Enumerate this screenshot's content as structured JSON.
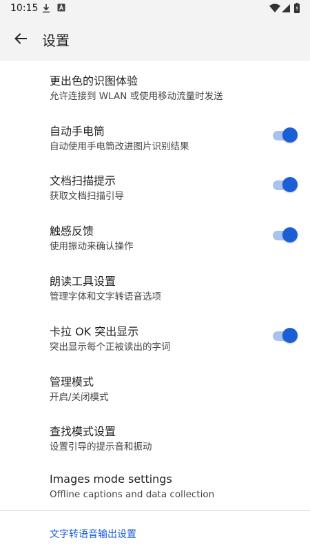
{
  "status_bar": {
    "time": "10:15",
    "icons": [
      "download-icon",
      "font-app-icon",
      "wifi-icon",
      "signal-icon",
      "battery-icon"
    ]
  },
  "app_bar": {
    "title": "设置",
    "back_icon": "arrow-back-icon"
  },
  "settings": [
    {
      "title": "更出色的识图体验",
      "subtitle": "允许连接到 WLAN 或使用移动流量时发送",
      "has_toggle": false
    },
    {
      "title": "自动手电筒",
      "subtitle": "自动使用手电筒改进图片识别结果",
      "has_toggle": true,
      "on": true
    },
    {
      "title": "文档扫描提示",
      "subtitle": "获取文档扫描引导",
      "has_toggle": true,
      "on": true
    },
    {
      "title": "触感反馈",
      "subtitle": "使用振动来确认操作",
      "has_toggle": true,
      "on": true
    },
    {
      "title": "朗读工具设置",
      "subtitle": "管理字体和文字转语音选项",
      "has_toggle": false
    },
    {
      "title": "卡拉 OK 突出显示",
      "subtitle": "突出显示每个正被读出的字词",
      "has_toggle": true,
      "on": true
    },
    {
      "title": "管理模式",
      "subtitle": "开启/关闭模式",
      "has_toggle": false
    },
    {
      "title": "查找模式设置",
      "subtitle": "设置引导的提示音和振动",
      "has_toggle": false
    },
    {
      "title": "Images mode settings",
      "subtitle": "Offline captions and data collection",
      "has_toggle": false
    }
  ],
  "footer_link": "文字转语音输出设置",
  "colors": {
    "accent": "#1a5fd6",
    "track": "#a9c3f0",
    "header_bg": "#f3f3f3"
  }
}
